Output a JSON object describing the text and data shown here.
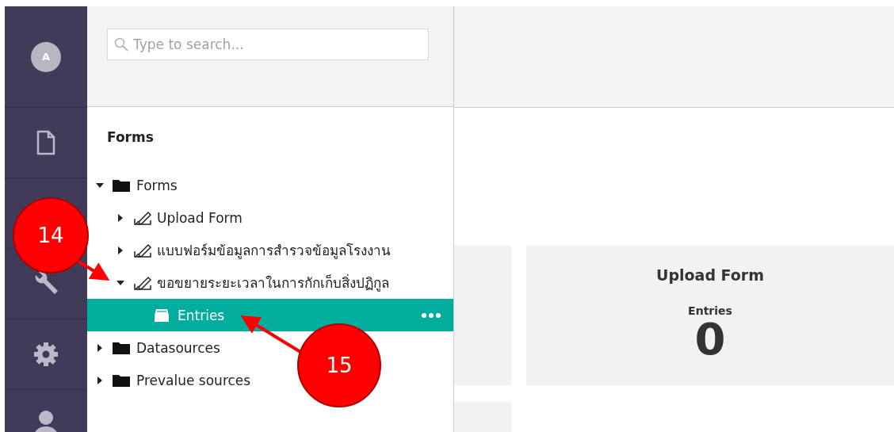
{
  "rail": {
    "avatar": "A",
    "items": [
      {
        "kind": "document",
        "selected": false
      },
      {
        "kind": "wrench",
        "selected": false
      },
      {
        "kind": "gear",
        "selected": false
      },
      {
        "kind": "user",
        "selected": false
      }
    ]
  },
  "search": {
    "placeholder": "Type to search..."
  },
  "tree": {
    "title": "Forms",
    "items": [
      {
        "label": "Forms",
        "kind": "folder",
        "expanded": true,
        "selected": false,
        "children": [
          {
            "label": "Upload Form",
            "kind": "form",
            "expanded": false,
            "selected": false
          },
          {
            "label": "แบบฟอร์มข้อมูลการสำรวจข้อมูลโรงงาน",
            "kind": "form",
            "expanded": false,
            "selected": false
          },
          {
            "label": "ขอขยายระยะเวลาในการกักเก็บสิ่งปฏิกูล",
            "kind": "form",
            "expanded": true,
            "selected": false,
            "children": [
              {
                "label": "Entries",
                "kind": "entries",
                "selected": true
              }
            ]
          }
        ]
      },
      {
        "label": "Datasources",
        "kind": "folder",
        "expanded": false,
        "selected": false
      },
      {
        "label": "Prevalue sources",
        "kind": "folder",
        "expanded": false,
        "selected": false
      }
    ]
  },
  "card": {
    "title": "Upload Form",
    "stat_label": "Entries",
    "stat_value": "0"
  },
  "annotations": [
    {
      "label": "14"
    },
    {
      "label": "15"
    }
  ]
}
